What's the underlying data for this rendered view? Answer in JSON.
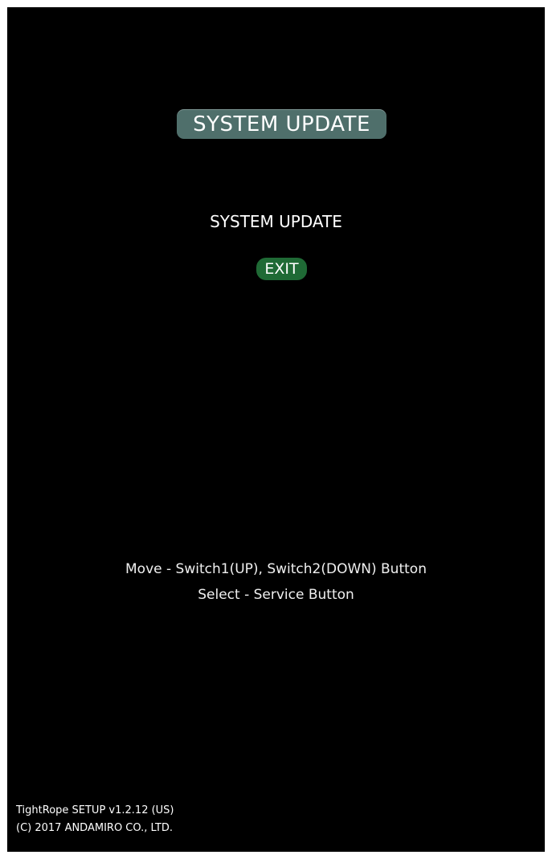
{
  "header": {
    "title": "SYSTEM UPDATE"
  },
  "menu": {
    "items": [
      {
        "label": "SYSTEM UPDATE",
        "selected": false
      },
      {
        "label": "EXIT",
        "selected": true
      }
    ]
  },
  "help": {
    "move": "Move - Switch1(UP), Switch2(DOWN) Button",
    "select": "Select - Service Button"
  },
  "footer": {
    "version": "TightRope SETUP v1.2.12 (US)",
    "copyright": "(C) 2017 ANDAMIRO CO., LTD."
  },
  "colors": {
    "background": "#000000",
    "title_badge": "#4f6f6b",
    "selected_item": "#1f6a35"
  }
}
